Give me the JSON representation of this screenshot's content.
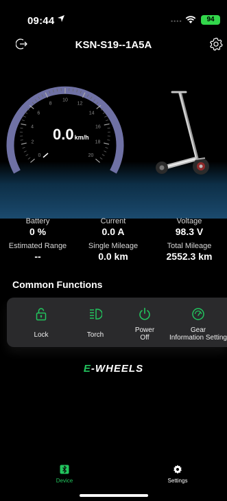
{
  "status_bar": {
    "time": "09:44",
    "battery": "94"
  },
  "header": {
    "title": "KSN-S19--1A5A"
  },
  "speedometer": {
    "speed": "0.0",
    "unit": "km/h",
    "ticks": [
      "0",
      "2",
      "4",
      "6",
      "8",
      "10",
      "12",
      "14",
      "16",
      "18",
      "20"
    ]
  },
  "stats": [
    {
      "label": "Battery",
      "value": "0 %"
    },
    {
      "label": "Current",
      "value": "0.0 A"
    },
    {
      "label": "Voltage",
      "value": "98.3 V"
    },
    {
      "label": "Estimated Range",
      "value": "--"
    },
    {
      "label": "Single Mileage",
      "value": "0.0 km"
    },
    {
      "label": "Total Mileage",
      "value": "2552.3 km"
    }
  ],
  "functions": {
    "title": "Common Functions",
    "items": [
      {
        "label": "Lock",
        "icon": "lock-icon"
      },
      {
        "label": "Torch",
        "icon": "headlight-icon"
      },
      {
        "label": "Power\nOff",
        "icon": "power-icon"
      },
      {
        "label": "Gear\nInformation Setting",
        "icon": "gauge-icon"
      }
    ]
  },
  "brand": {
    "prefix": "E",
    "name": "-WHEELS"
  },
  "bottom_nav": {
    "items": [
      {
        "label": "Device",
        "icon": "bluetooth-icon",
        "active": true
      },
      {
        "label": "Settings",
        "icon": "gear-icon",
        "active": false
      }
    ]
  },
  "colors": {
    "accent": "#22c55e",
    "gauge_arc": "#6f71a4",
    "panel": "#2a2a2c"
  }
}
